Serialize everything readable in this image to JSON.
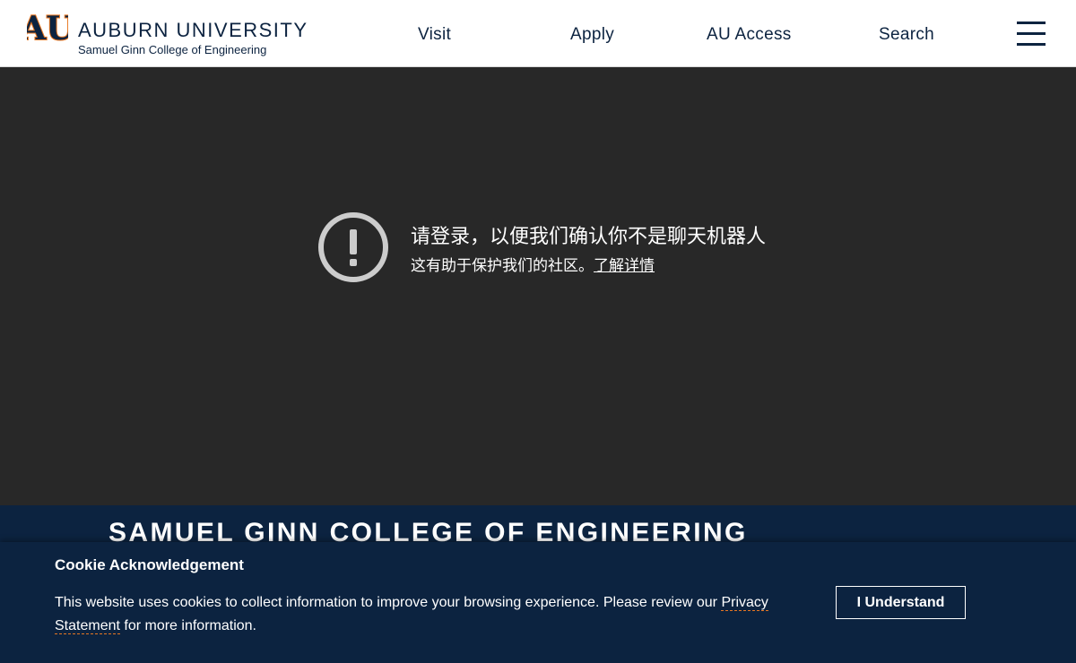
{
  "header": {
    "brand_name": "AUBURN UNIVERSITY",
    "brand_sub": "Samuel Ginn College of Engineering",
    "logo_icon": "au-logo-icon",
    "nav": {
      "visit": "Visit",
      "apply": "Apply",
      "au_access": "AU Access",
      "search": "Search"
    },
    "menu_icon": "hamburger-menu-icon"
  },
  "challenge": {
    "icon": "exclamation-circle-icon",
    "title": "请登录，以便我们确认你不是聊天机器人",
    "subtitle": "这有助于保护我们的社区。",
    "link": "了解详情"
  },
  "footer": {
    "title": "SAMUEL GINN COLLEGE OF ENGINEERING"
  },
  "cookie": {
    "title": "Cookie Acknowledgement",
    "text_before": "This website uses cookies to collect information to improve your browsing experience. Please review our ",
    "link": "Privacy Statement",
    "text_after": " for more information.",
    "button": "I Understand"
  },
  "colors": {
    "navy": "#0c2340",
    "orange": "#e87722",
    "dark_bg": "#282828",
    "icon_gray": "#cccccc"
  }
}
